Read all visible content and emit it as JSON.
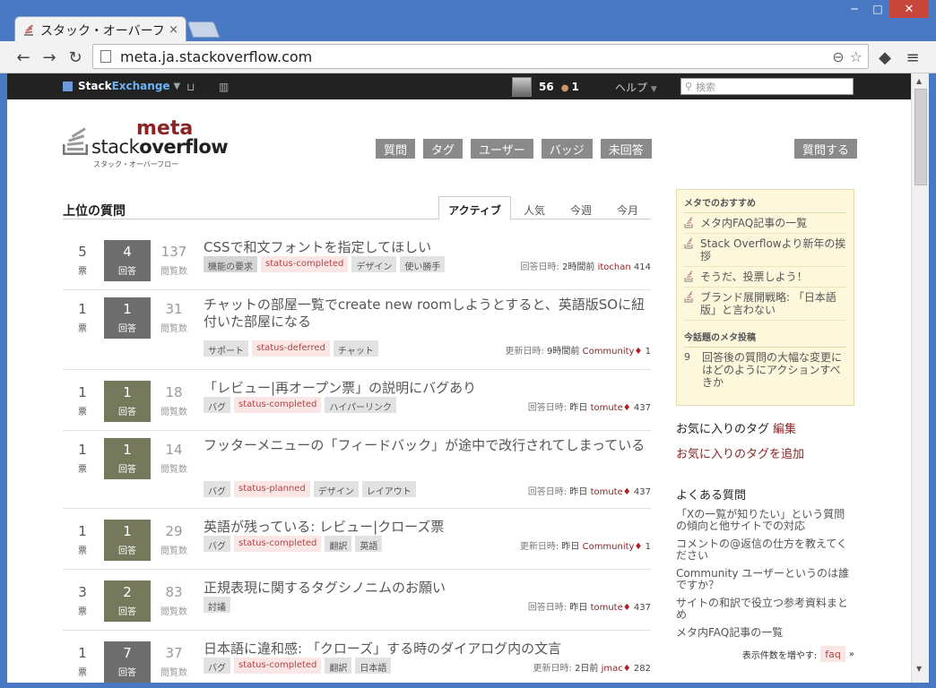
{
  "browser": {
    "tab_title": "スタック・オーバーフ口",
    "tab_close": "×",
    "url": "meta.ja.stackoverflow.com",
    "window_controls": [
      "─",
      "□",
      "✕"
    ]
  },
  "topbar": {
    "brand_stack": "Stack",
    "brand_exchange": "Exchange",
    "reputation": "56",
    "bronze_badges": "1",
    "help": "ヘルプ",
    "search_placeholder": "検索"
  },
  "logo": {
    "meta": "meta",
    "stack": "stack",
    "overflow": "overflow",
    "kana": "スタック・オーバーフロー"
  },
  "nav": {
    "items": [
      "質問",
      "タグ",
      "ユーザー",
      "バッジ",
      "未回答"
    ],
    "ask": "質問する"
  },
  "main": {
    "heading": "上位の質問",
    "tabs": [
      "アクティブ",
      "人気",
      "今週",
      "今月"
    ],
    "vote_label": "票",
    "answer_label": "回答",
    "view_label": "閲覧数",
    "questions": [
      {
        "votes": "5",
        "answers": "4",
        "views": "137",
        "accepted": false,
        "title": "CSSで和文フォントを指定してほしい",
        "tags": [
          {
            "name": "機能の要求",
            "kind": "req"
          },
          {
            "name": "status-completed",
            "kind": "status"
          },
          {
            "name": "デザイン",
            "kind": "normal"
          },
          {
            "name": "使い勝手",
            "kind": "normal"
          }
        ],
        "action": "回答日時:",
        "time": "2時間前",
        "user": "itochan",
        "mod": "",
        "rep": "414"
      },
      {
        "votes": "1",
        "answers": "1",
        "views": "31",
        "accepted": false,
        "title": "チャットの部屋一覧でcreate new roomしようとすると、英語版SOに紐付いた部屋になる",
        "tags": [
          {
            "name": "サポート",
            "kind": "normal"
          },
          {
            "name": "status-deferred",
            "kind": "status"
          },
          {
            "name": "チャット",
            "kind": "normal"
          }
        ],
        "action": "更新日時:",
        "time": "9時間前",
        "user": "Community",
        "mod": "♦",
        "rep": "1"
      },
      {
        "votes": "1",
        "answers": "1",
        "views": "18",
        "accepted": true,
        "title": "「レビュー|再オープン票」の説明にバグあり",
        "tags": [
          {
            "name": "バグ",
            "kind": "normal"
          },
          {
            "name": "status-completed",
            "kind": "status"
          },
          {
            "name": "ハイパーリンク",
            "kind": "normal"
          }
        ],
        "action": "回答日時:",
        "time": "昨日",
        "user": "tomute",
        "mod": "♦",
        "rep": "437"
      },
      {
        "votes": "1",
        "answers": "1",
        "views": "14",
        "accepted": true,
        "title": "フッターメニューの「フィードバック」が途中で改行されてしまっている",
        "tags": [
          {
            "name": "バグ",
            "kind": "normal"
          },
          {
            "name": "status-planned",
            "kind": "status"
          },
          {
            "name": "デザイン",
            "kind": "normal"
          },
          {
            "name": "レイアウト",
            "kind": "normal"
          }
        ],
        "action": "回答日時:",
        "time": "昨日",
        "user": "tomute",
        "mod": "♦",
        "rep": "437"
      },
      {
        "votes": "1",
        "answers": "1",
        "views": "29",
        "accepted": true,
        "title": "英語が残っている: レビュー|クローズ票",
        "tags": [
          {
            "name": "バグ",
            "kind": "normal"
          },
          {
            "name": "status-completed",
            "kind": "status"
          },
          {
            "name": "翻訳",
            "kind": "normal"
          },
          {
            "name": "英語",
            "kind": "normal"
          }
        ],
        "action": "更新日時:",
        "time": "昨日",
        "user": "Community",
        "mod": "♦",
        "rep": "1"
      },
      {
        "votes": "3",
        "answers": "2",
        "views": "83",
        "accepted": true,
        "title": "正規表現に関するタグシノニムのお願い",
        "tags": [
          {
            "name": "討議",
            "kind": "normal"
          }
        ],
        "action": "回答日時:",
        "time": "昨日",
        "user": "tomute",
        "mod": "♦",
        "rep": "437"
      },
      {
        "votes": "1",
        "answers": "7",
        "views": "37",
        "accepted": false,
        "title": "日本語に違和感: 「クローズ」する時のダイアログ内の文言",
        "tags": [
          {
            "name": "バグ",
            "kind": "normal"
          },
          {
            "name": "status-completed",
            "kind": "status"
          },
          {
            "name": "翻訳",
            "kind": "normal"
          },
          {
            "name": "日本語",
            "kind": "normal"
          }
        ],
        "action": "更新日時:",
        "time": "2日前",
        "user": "jmac",
        "mod": "♦",
        "rep": "282"
      }
    ]
  },
  "sidebar": {
    "recommend_head": "メタでのおすすめ",
    "recommend": [
      "メタ内FAQ記事の一覧",
      "Stack Overflowより新年の挨拶",
      "そうだ、投票しよう！",
      "ブランド展開戦略: 「日本語版」と言わない"
    ],
    "hot_head": "今話題のメタ投稿",
    "hot": [
      {
        "count": "9",
        "title": "回答後の質問の大幅な変更にはどのようにアクションすべきか"
      }
    ],
    "fav_title": "お気に入りのタグ",
    "fav_edit": "編集",
    "fav_add": "お気に入りのタグを追加",
    "faq_title": "よくある質問",
    "faq": [
      "「Xの一覧が知りたい」という質問の傾向と他サイトでの対応",
      "コメントの@返信の仕方を教えてください",
      "Community ユーザーというのは誰ですか？",
      "サイトの和訳で役立つ参考資料まとめ",
      "メタ内FAQ記事の一覧"
    ],
    "faq_more_label": "表示件数を増やす:",
    "faq_more_tag": "faq",
    "faq_more_arrow": "»"
  }
}
